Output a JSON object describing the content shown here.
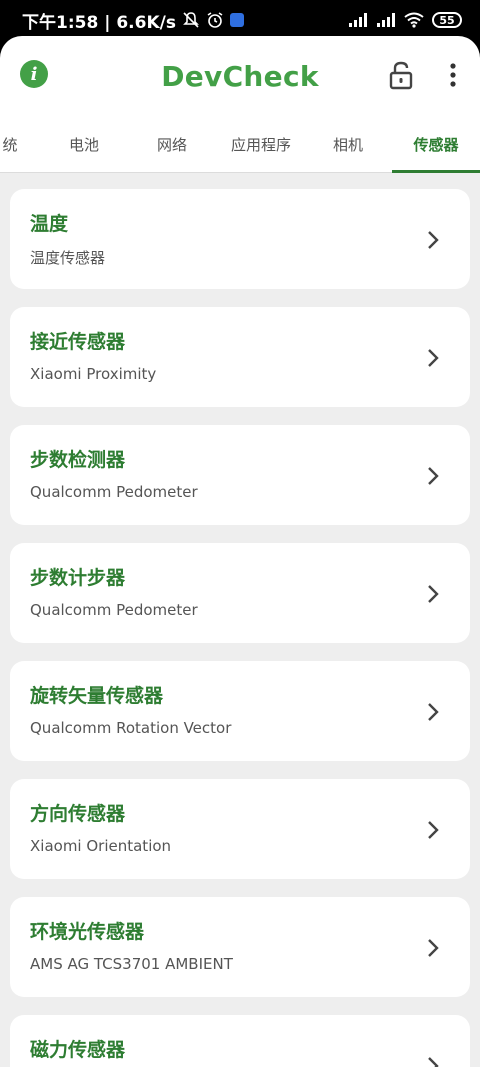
{
  "status_bar": {
    "time_speed": "下午1:58 | 6.6K/s",
    "battery": "55"
  },
  "app_bar": {
    "title": "DevCheck"
  },
  "tabs": [
    {
      "label": "统"
    },
    {
      "label": "电池"
    },
    {
      "label": "网络"
    },
    {
      "label": "应用程序"
    },
    {
      "label": "相机"
    },
    {
      "label": "传感器",
      "active": true
    }
  ],
  "sensors": [
    {
      "title": "温度",
      "subtitle": "温度传感器"
    },
    {
      "title": "接近传感器",
      "subtitle": "Xiaomi Proximity"
    },
    {
      "title": "步数检测器",
      "subtitle": "Qualcomm Pedometer"
    },
    {
      "title": "步数计步器",
      "subtitle": "Qualcomm Pedometer"
    },
    {
      "title": "旋转矢量传感器",
      "subtitle": "Qualcomm Rotation Vector"
    },
    {
      "title": "方向传感器",
      "subtitle": "Xiaomi Orientation"
    },
    {
      "title": "环境光传感器",
      "subtitle": "AMS AG TCS3701 AMBIENT"
    },
    {
      "title": "磁力传感器",
      "subtitle": ""
    }
  ],
  "colors": {
    "accent": "#43a047",
    "title_green": "#2e7d32",
    "list_bg": "#eeeeee"
  },
  "icons": [
    "info-icon",
    "lock-open-icon",
    "more-vert-icon",
    "chevron-right-icon",
    "signal-icon",
    "wifi-icon",
    "alarm-icon",
    "mute-icon",
    "battery-icon"
  ]
}
